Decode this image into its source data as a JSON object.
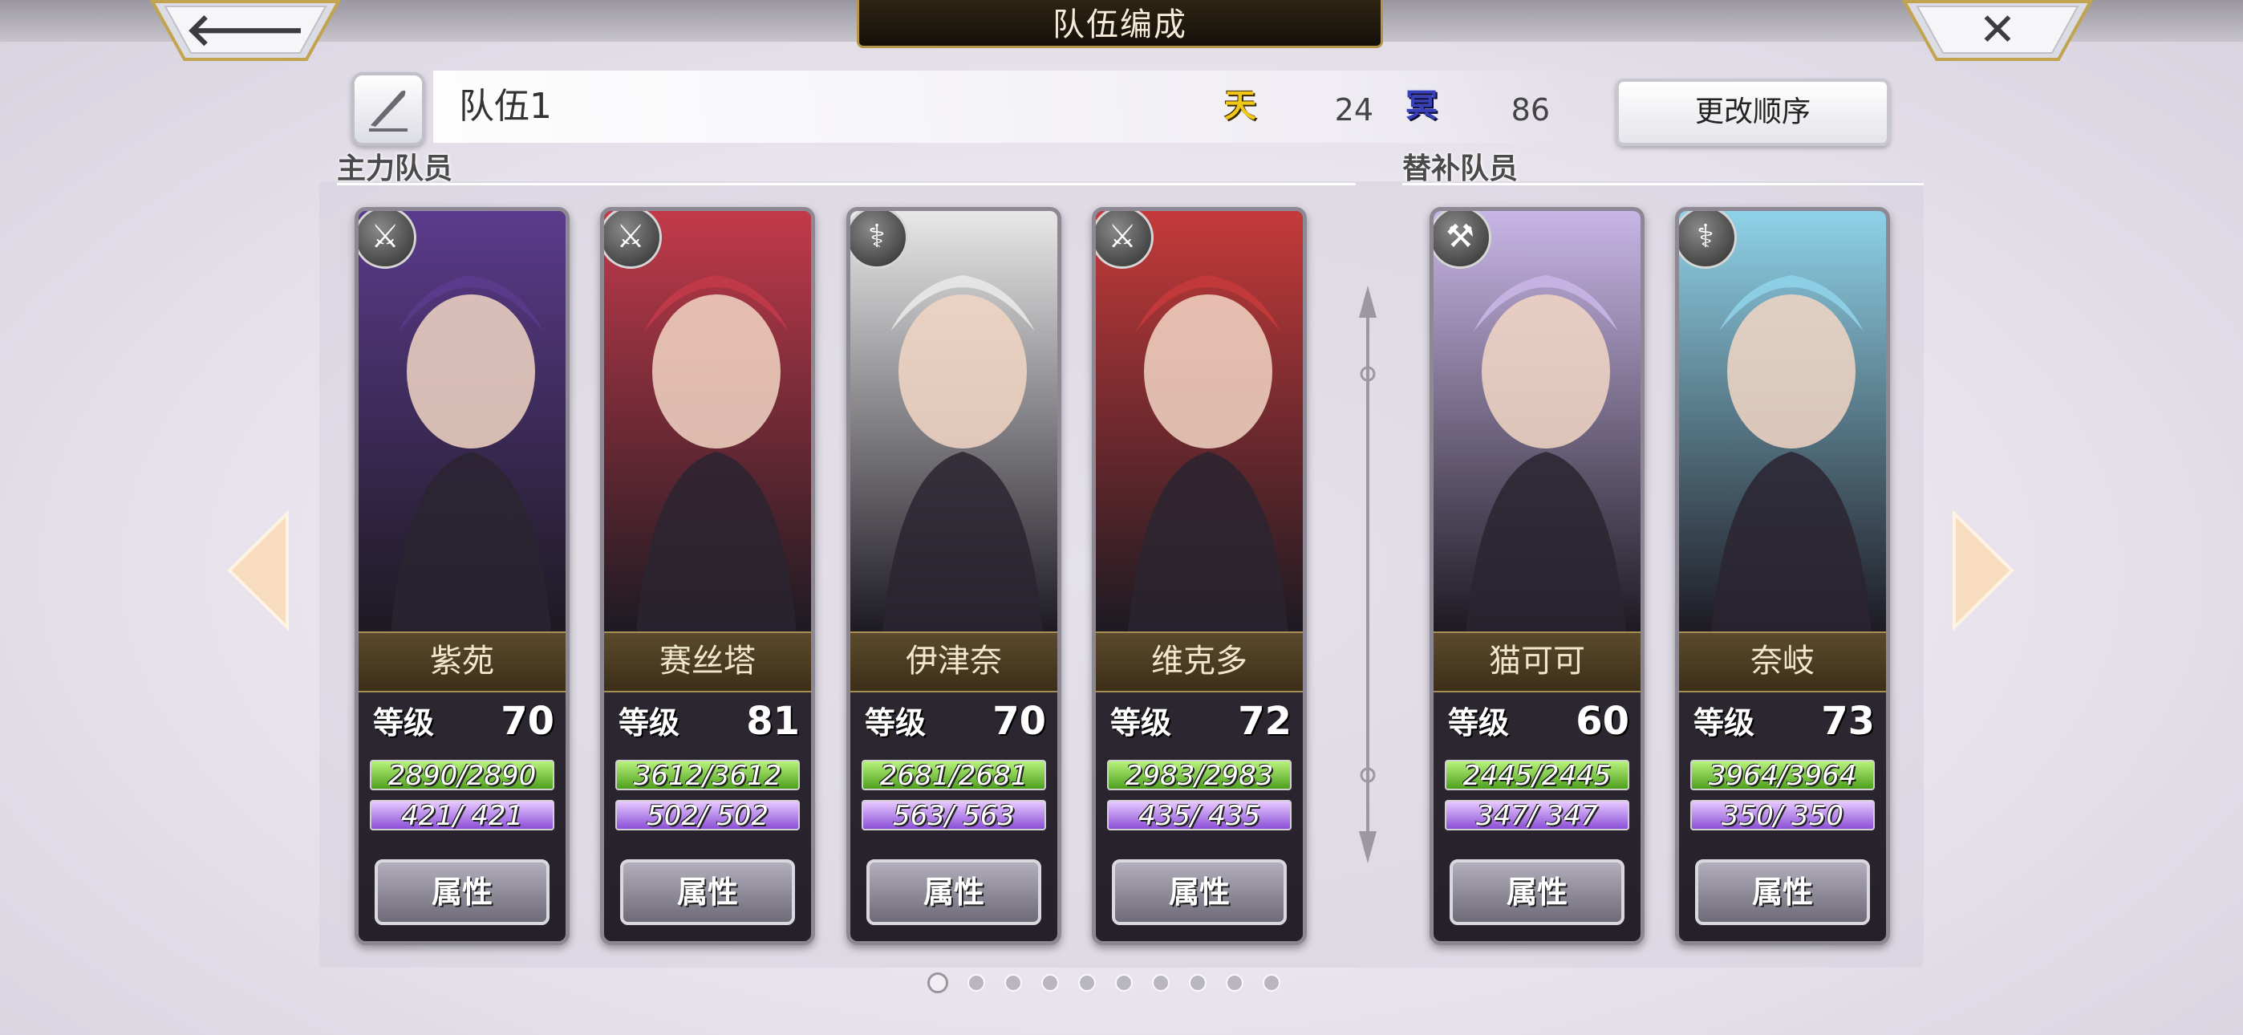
{
  "header": {
    "title": "队伍编成",
    "back_icon": "arrow-left-icon",
    "close_icon": "close-icon"
  },
  "team": {
    "name": "队伍1",
    "heaven_label": "天",
    "heaven_value": "24",
    "hell_label": "冥",
    "hell_value": "86",
    "order_button": "更改顺序"
  },
  "sections": {
    "main": "主力队员",
    "sub": "替补队员"
  },
  "members": [
    {
      "name": "紫苑",
      "level_label": "等级",
      "level": "70",
      "hp": "2890/2890",
      "mp": "421/ 421",
      "attr_button": "属性",
      "weapon_icon": "sword-icon",
      "accent": "#5b3b8c"
    },
    {
      "name": "赛丝塔",
      "level_label": "等级",
      "level": "81",
      "hp": "3612/3612",
      "mp": "502/ 502",
      "attr_button": "属性",
      "weapon_icon": "sword-icon",
      "accent": "#c23a4a"
    },
    {
      "name": "伊津奈",
      "level_label": "等级",
      "level": "70",
      "hp": "2681/2681",
      "mp": "563/ 563",
      "attr_button": "属性",
      "weapon_icon": "staff-icon",
      "accent": "#e8e8e8"
    },
    {
      "name": "维克多",
      "level_label": "等级",
      "level": "72",
      "hp": "2983/2983",
      "mp": "435/ 435",
      "attr_button": "属性",
      "weapon_icon": "sword-icon",
      "accent": "#c53a3a"
    },
    {
      "name": "猫可可",
      "level_label": "等级",
      "level": "60",
      "hp": "2445/2445",
      "mp": "347/ 347",
      "attr_button": "属性",
      "weapon_icon": "axe-icon",
      "accent": "#c8b6e6"
    },
    {
      "name": "奈岐",
      "level_label": "等级",
      "level": "73",
      "hp": "3964/3964",
      "mp": "350/ 350",
      "attr_button": "属性",
      "weapon_icon": "staff-icon",
      "accent": "#8fd2e8"
    }
  ],
  "pagination": {
    "total": 10,
    "current": 1
  },
  "colors": {
    "hp_bar": "#6cc22c",
    "mp_bar": "#a66ef0",
    "name_plate": "#4d3c22",
    "title_plate": "#1e170d"
  }
}
